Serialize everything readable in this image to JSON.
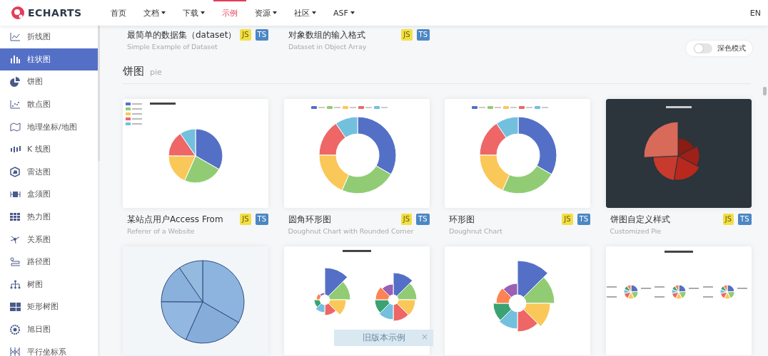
{
  "logo": {
    "text": "ECHARTS"
  },
  "nav": {
    "items": [
      {
        "label": "首页",
        "selected": false,
        "has_menu": false
      },
      {
        "label": "文档",
        "selected": false,
        "has_menu": true
      },
      {
        "label": "下载",
        "selected": false,
        "has_menu": true
      },
      {
        "label": "示例",
        "selected": true,
        "has_menu": false
      },
      {
        "label": "资源",
        "selected": false,
        "has_menu": true
      },
      {
        "label": "社区",
        "selected": false,
        "has_menu": true
      },
      {
        "label": "ASF",
        "selected": false,
        "has_menu": true
      }
    ],
    "language": "EN"
  },
  "sidebar": {
    "items": [
      {
        "label": "折线图",
        "selected": false
      },
      {
        "label": "柱状图",
        "selected": true
      },
      {
        "label": "饼图",
        "selected": false
      },
      {
        "label": "散点图",
        "selected": false
      },
      {
        "label": "地理坐标/地图",
        "selected": false
      },
      {
        "label": "K 线图",
        "selected": false
      },
      {
        "label": "雷达图",
        "selected": false
      },
      {
        "label": "盒须图",
        "selected": false
      },
      {
        "label": "热力图",
        "selected": false
      },
      {
        "label": "关系图",
        "selected": false
      },
      {
        "label": "路径图",
        "selected": false
      },
      {
        "label": "树图",
        "selected": false
      },
      {
        "label": "矩形树图",
        "selected": false
      },
      {
        "label": "旭日图",
        "selected": false
      },
      {
        "label": "平行坐标系",
        "selected": false
      }
    ]
  },
  "dark_mode": {
    "label": "深色模式",
    "on": false
  },
  "previous_examples": [
    {
      "title": "最简单的数据集（dataset）",
      "subtitle": "Simple Example of Dataset",
      "badges": [
        {
          "label": "JS",
          "color": "#f2df45"
        },
        {
          "label": "TS",
          "color": "#4c87c4"
        }
      ]
    },
    {
      "title": "对象数组的输入格式",
      "subtitle": "Dataset in Object Array",
      "badges": [
        {
          "label": "JS",
          "color": "#f2df45"
        },
        {
          "label": "TS",
          "color": "#4c87c4"
        }
      ]
    }
  ],
  "section": {
    "title": "饼图",
    "subtitle": "pie"
  },
  "examples": [
    {
      "kind": "pie",
      "title": "某站点用户Access From",
      "subtitle": "Referer of a Website",
      "badges": [
        {
          "label": "JS",
          "color": "#f2df45"
        },
        {
          "label": "TS",
          "color": "#4c87c4"
        }
      ]
    },
    {
      "kind": "rounded-doughnut",
      "title": "圆角环形图",
      "subtitle": "Doughnut Chart with Rounded Corner",
      "badges": [
        {
          "label": "JS",
          "color": "#f2df45"
        },
        {
          "label": "TS",
          "color": "#4c87c4"
        }
      ]
    },
    {
      "kind": "doughnut",
      "title": "环形图",
      "subtitle": "Doughnut Chart",
      "badges": [
        {
          "label": "JS",
          "color": "#f2df45"
        },
        {
          "label": "TS",
          "color": "#4c87c4"
        }
      ]
    },
    {
      "kind": "custom-pie",
      "title": "饼图自定义样式",
      "subtitle": "Customized Pie",
      "badges": [
        {
          "label": "JS",
          "color": "#f2df45"
        },
        {
          "label": "TS",
          "color": "#4c87c4"
        }
      ]
    },
    {
      "kind": "texture-pie"
    },
    {
      "kind": "nightingale-pair"
    },
    {
      "kind": "nightingale"
    },
    {
      "kind": "label-align"
    }
  ],
  "toast": {
    "text": "旧版本示例",
    "close": "×"
  }
}
